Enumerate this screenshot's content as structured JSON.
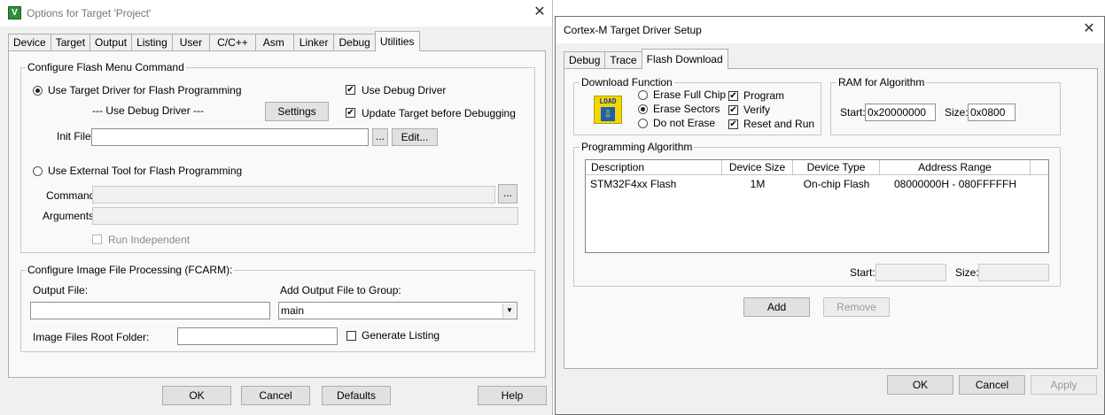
{
  "options_window": {
    "title": "Options for Target 'Project'",
    "tabs": [
      "Device",
      "Target",
      "Output",
      "Listing",
      "User",
      "C/C++",
      "Asm",
      "Linker",
      "Debug",
      "Utilities"
    ],
    "active_tab": "Utilities",
    "flash_group": {
      "legend": "Configure Flash Menu Command",
      "use_target_driver": "Use Target Driver for Flash Programming",
      "use_debug_driver": "Use Debug Driver",
      "driver_label": "--- Use Debug Driver ---",
      "settings_button": "Settings",
      "update_target": "Update Target before Debugging",
      "init_file_label": "Init File:",
      "init_file_value": "",
      "browse_button": "...",
      "edit_button": "Edit...",
      "use_external_tool": "Use External Tool for Flash Programming",
      "command_label": "Command:",
      "command_value": "",
      "arguments_label": "Arguments:",
      "arguments_value": "",
      "run_independent": "Run Independent"
    },
    "image_group": {
      "legend": "Configure Image File Processing (FCARM):",
      "output_file_label": "Output File:",
      "output_file_value": "",
      "add_output_label": "Add Output File  to Group:",
      "group_value": "main",
      "root_folder_label": "Image Files Root Folder:",
      "root_folder_value": "",
      "generate_listing": "Generate Listing"
    },
    "buttons": {
      "ok": "OK",
      "cancel": "Cancel",
      "defaults": "Defaults",
      "help": "Help"
    },
    "state": {
      "use_target_driver": true,
      "use_external_tool": false,
      "use_debug_driver": true,
      "update_target": true,
      "run_independent": false,
      "generate_listing": false
    }
  },
  "driver_window": {
    "title": "Cortex-M Target Driver Setup",
    "tabs": [
      "Debug",
      "Trace",
      "Flash Download"
    ],
    "active_tab": "Flash Download",
    "download_function": {
      "legend": "Download Function",
      "icon_text": "LOAD",
      "erase_full_chip": "Erase Full Chip",
      "erase_sectors": "Erase Sectors",
      "do_not_erase": "Do not Erase",
      "program": "Program",
      "verify": "Verify",
      "reset_and_run": "Reset and Run"
    },
    "ram": {
      "legend": "RAM for Algorithm",
      "start_label": "Start:",
      "start_value": "0x20000000",
      "size_label": "Size:",
      "size_value": "0x0800"
    },
    "algorithm": {
      "legend": "Programming Algorithm",
      "columns": [
        "Description",
        "Device Size",
        "Device Type",
        "Address Range"
      ],
      "rows": [
        {
          "description": "STM32F4xx Flash",
          "size": "1M",
          "type": "On-chip Flash",
          "range": "08000000H - 080FFFFFH"
        }
      ],
      "start_label": "Start:",
      "start_value": "",
      "size_label": "Size:",
      "size_value": ""
    },
    "add_button": "Add",
    "remove_button": "Remove",
    "buttons": {
      "ok": "OK",
      "cancel": "Cancel",
      "apply": "Apply"
    },
    "state": {
      "erase_mode": "Erase Sectors",
      "program": true,
      "verify": true,
      "reset_and_run": true
    }
  },
  "colors": {
    "accent_icon": "#1a5fb4",
    "load_icon_bg": "#f2d600"
  }
}
